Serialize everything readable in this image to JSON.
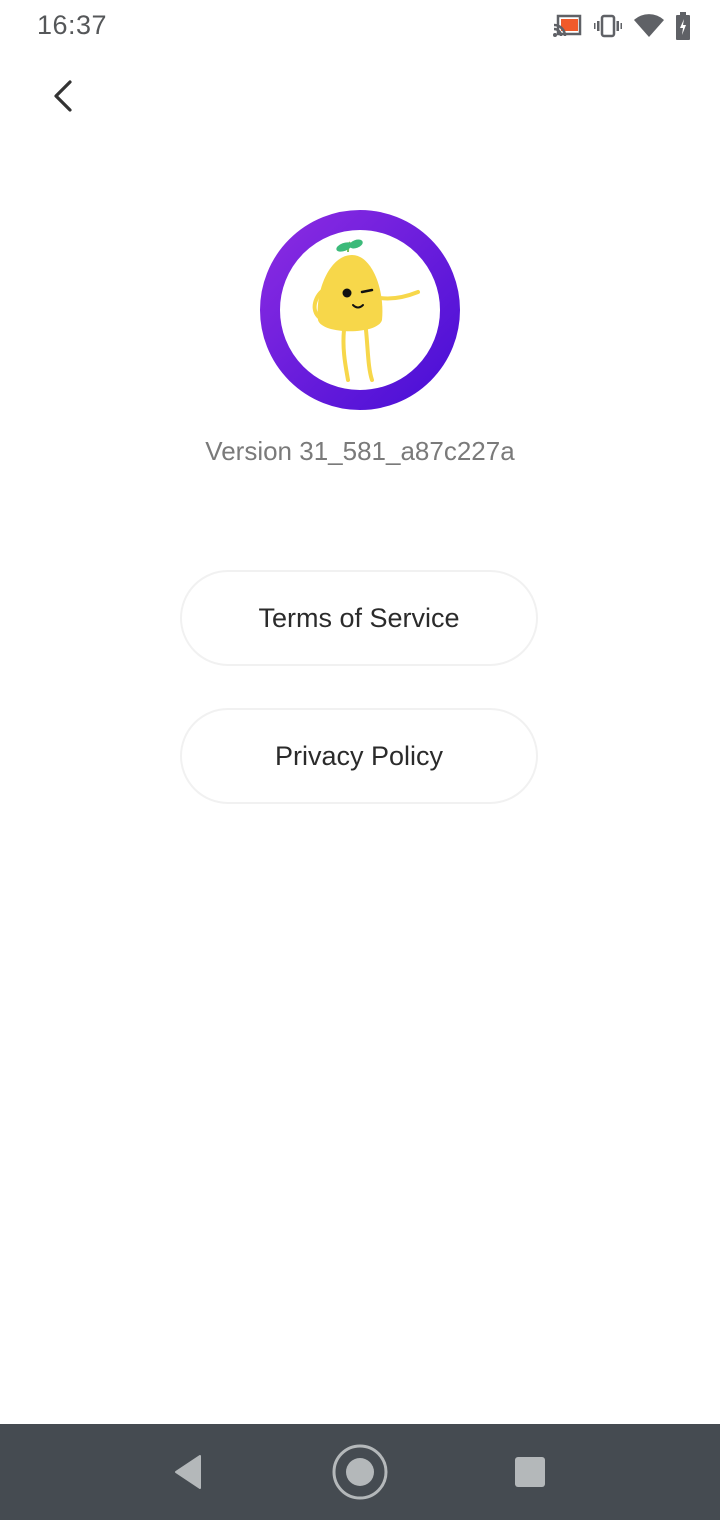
{
  "status_bar": {
    "time": "16:37",
    "icons": [
      "cast-icon",
      "vibrate-icon",
      "wifi-icon",
      "battery-charging-icon"
    ],
    "cast_color": "#f05a2a"
  },
  "header": {
    "back_icon": "chevron-left-icon"
  },
  "about": {
    "logo": "mascot-logo",
    "ring_colors": [
      "#8a2be2",
      "#4a0fd6"
    ],
    "version": "Version 31_581_a87c227a"
  },
  "links": {
    "terms_label": "Terms of Service",
    "privacy_label": "Privacy Policy"
  },
  "nav_bar": {
    "back": "nav-back-icon",
    "home": "nav-home-icon",
    "recents": "nav-recents-icon"
  }
}
